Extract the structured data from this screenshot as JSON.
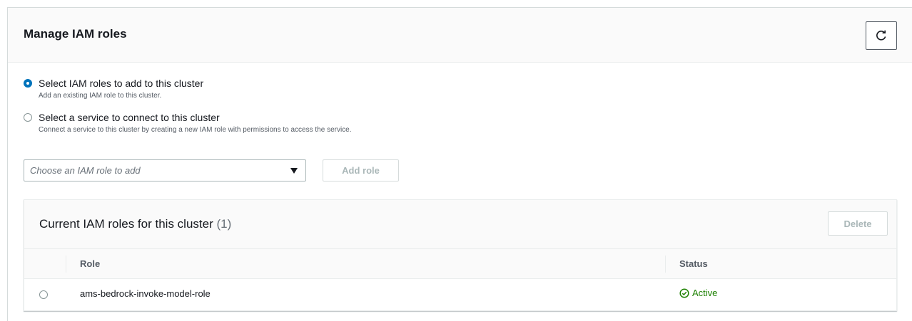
{
  "panel": {
    "title": "Manage IAM roles",
    "refresh_icon": "refresh-icon"
  },
  "options": [
    {
      "label": "Select IAM roles to add to this cluster",
      "description": "Add an existing IAM role to this cluster.",
      "selected": true
    },
    {
      "label": "Select a service to connect to this cluster",
      "description": "Connect a service to this cluster by creating a new IAM role with permissions to access the service.",
      "selected": false
    }
  ],
  "role_select": {
    "placeholder": "Choose an IAM role to add",
    "caret_icon": "caret-down-icon"
  },
  "add_role_label": "Add role",
  "roles_table": {
    "title": "Current IAM roles for this cluster",
    "count": "(1)",
    "delete_label": "Delete",
    "columns": [
      "Role",
      "Status"
    ],
    "rows": [
      {
        "role": "ams-bedrock-invoke-model-role",
        "status": "Active",
        "status_icon": "check-circle-icon"
      }
    ]
  },
  "colors": {
    "accent": "#0073bb",
    "success": "#1d8102"
  }
}
